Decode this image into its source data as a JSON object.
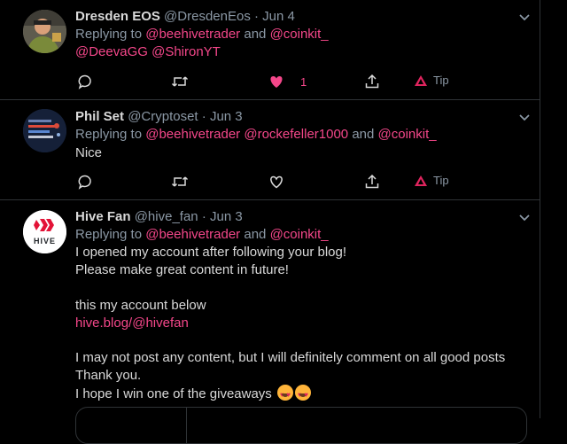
{
  "colors": {
    "accent": "#f4478a",
    "muted": "#8b98a5",
    "text": "#d9d9d9",
    "border": "#2f3336",
    "tip": "#e0245e"
  },
  "tweets": [
    {
      "name": "Dresden EOS",
      "handle": "@DresdenEos",
      "dot": "·",
      "date": "Jun 4",
      "reply_prefix": "Replying to",
      "mentions_line1": [
        "@beehivetrader",
        "@coinkit_"
      ],
      "conjunction": "and",
      "mentions_line2": [
        "@DeevaGG",
        "@ShironYT"
      ],
      "like_count": "1",
      "liked": true,
      "tip_label": "Tip"
    },
    {
      "name": "Phil Set",
      "handle": "@Cryptoset",
      "dot": "·",
      "date": "Jun 3",
      "reply_prefix": "Replying to",
      "mentions_line1": [
        "@beehivetrader",
        "@rockefeller1000",
        "@coinkit_"
      ],
      "conjunction": "and",
      "body": "Nice",
      "tip_label": "Tip"
    },
    {
      "name": "Hive Fan",
      "handle": "@hive_fan",
      "dot": "·",
      "date": "Jun 3",
      "avatar_text": "HIVE",
      "reply_prefix": "Replying to",
      "mentions_line1": [
        "@beehivetrader",
        "@coinkit_"
      ],
      "conjunction": "and",
      "body_lines": [
        "I opened my account after following your blog!",
        "Please make great content in future!",
        "",
        "this my account below"
      ],
      "link": "hive.blog/@hivefan",
      "body_lines2": [
        "I may not post any content, but I will definitely comment on all good posts",
        "Thank you.",
        "I hope I win one of the giveaways"
      ]
    }
  ],
  "icons": {
    "more": "chevron-down-icon",
    "reply": "reply-icon",
    "retweet": "retweet-icon",
    "like": "heart-icon",
    "share": "share-icon",
    "tip": "tip-triangle-icon"
  }
}
